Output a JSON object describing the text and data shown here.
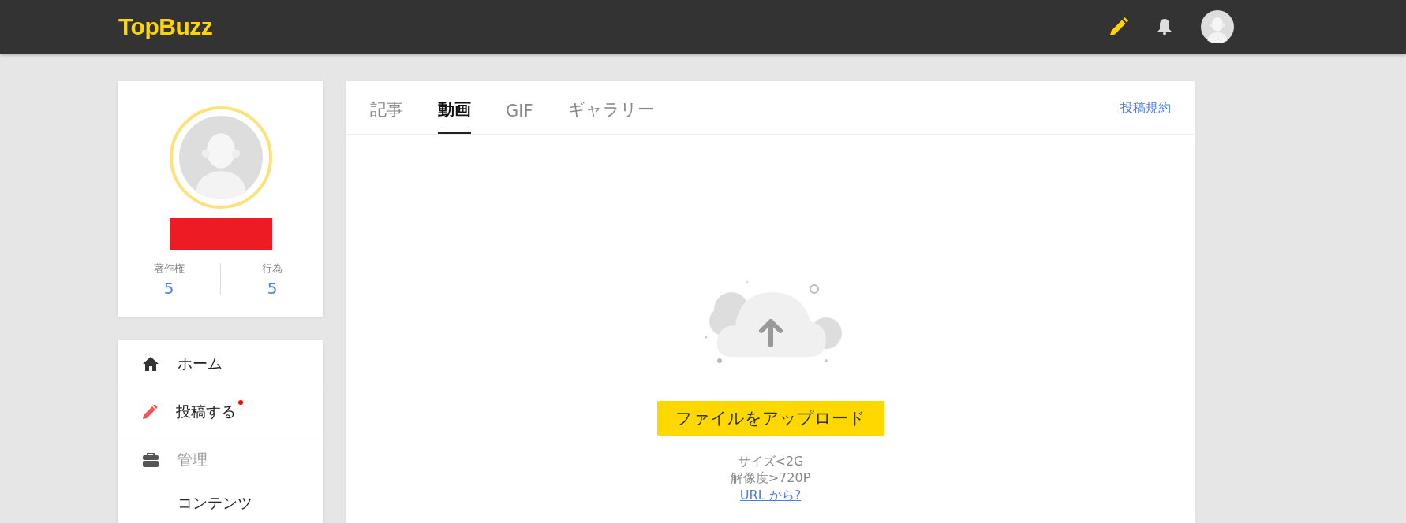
{
  "header": {
    "logo": "TopBuzz"
  },
  "profile": {
    "stats": [
      {
        "label": "著作権",
        "value": "5"
      },
      {
        "label": "行為",
        "value": "5"
      }
    ]
  },
  "menu": [
    {
      "kind": "item",
      "label": "ホーム",
      "dot": false
    },
    {
      "kind": "item",
      "label": "投稿する",
      "dot": true
    },
    {
      "kind": "group",
      "label": "管理",
      "children": [
        {
          "label": "コンテンツ"
        }
      ]
    }
  ],
  "tabs": [
    {
      "label": "記事",
      "selected": false
    },
    {
      "label": "動画",
      "selected": true
    },
    {
      "label": "GIF",
      "selected": false
    },
    {
      "label": "ギャラリー",
      "selected": false
    }
  ],
  "rules_link": "投稿規約",
  "upload": {
    "button": "ファイルをアップロード",
    "notes": [
      "サイズ<2G",
      "解像度>720P"
    ],
    "url_link": "URL から?"
  }
}
